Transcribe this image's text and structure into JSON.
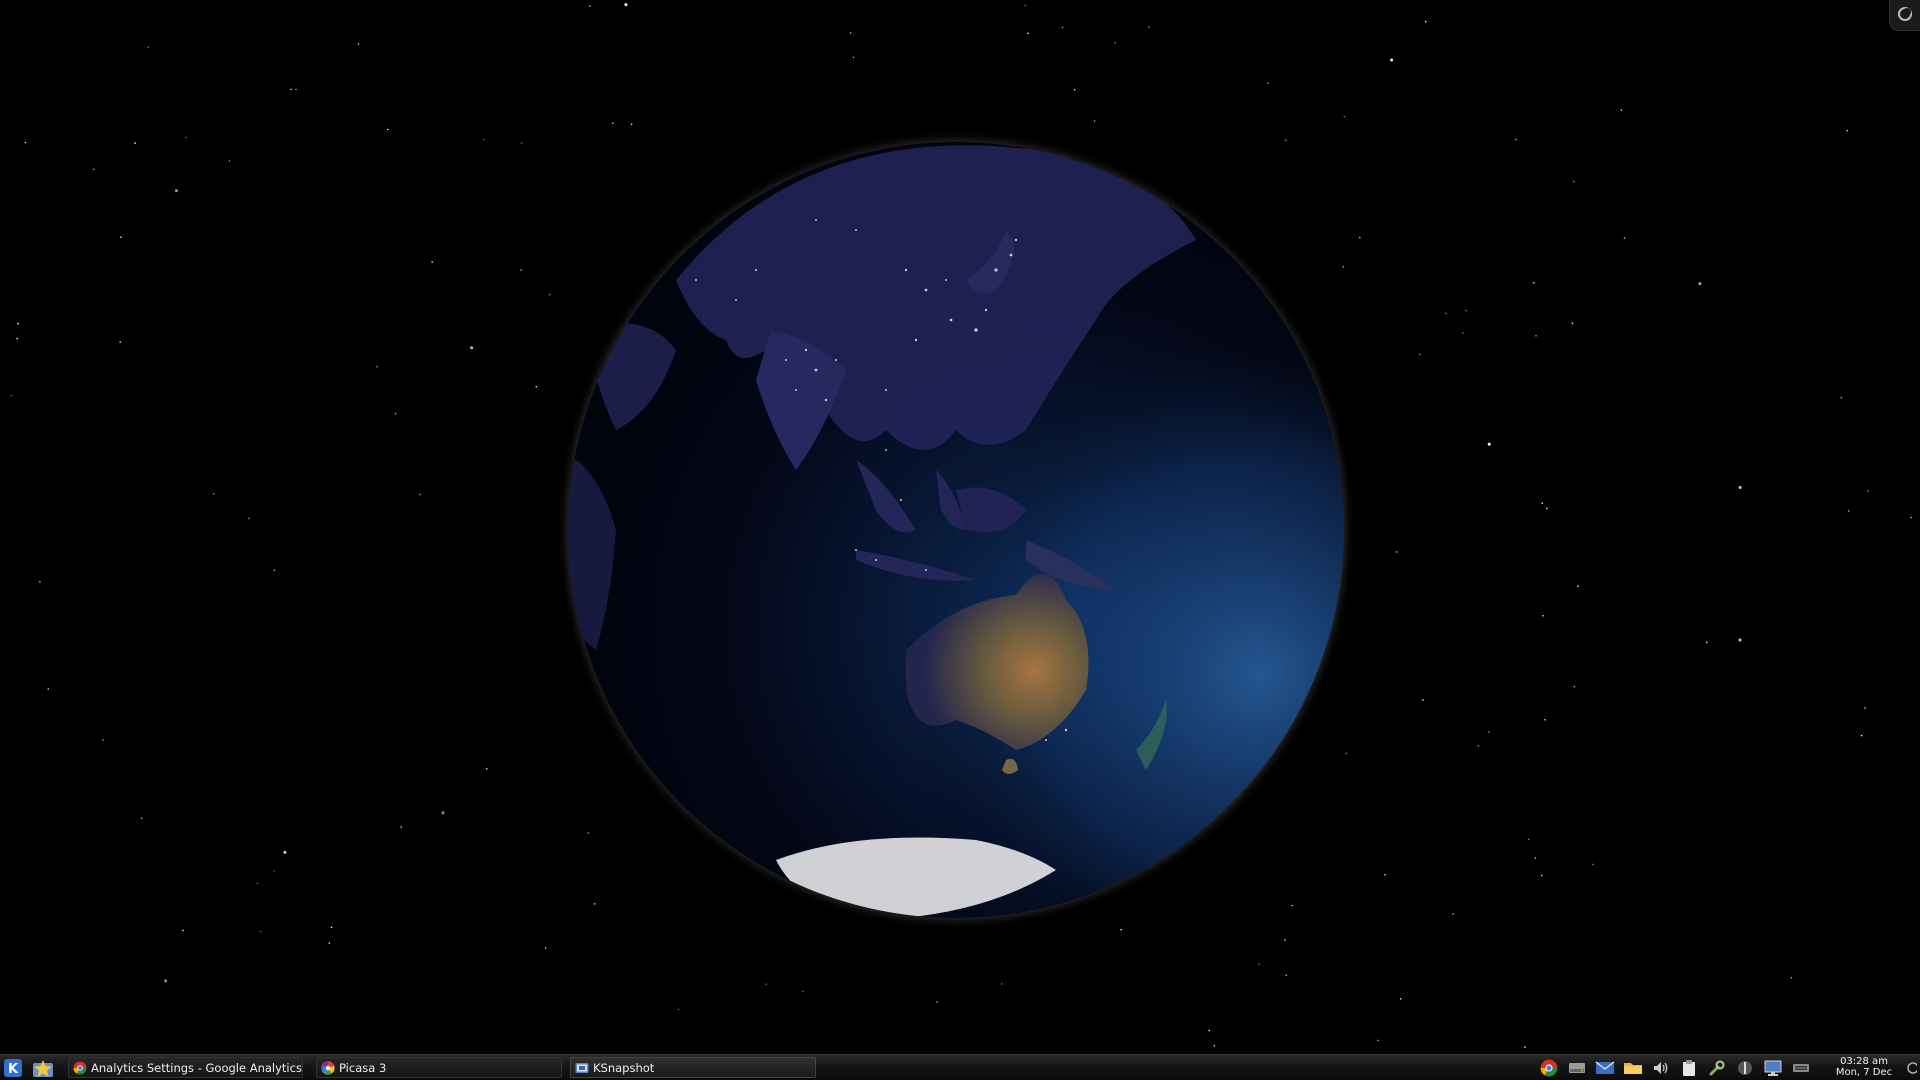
{
  "desktop": {
    "wallpaper": "earth-at-night-globe",
    "colors": {
      "space": "#000000",
      "ocean": "#0a0f2a",
      "land_night": "#2b2f6b",
      "australia_day": "#b07a45",
      "antarctica": "#f4f6fb",
      "atmosphere_glow": "#e8e8e8"
    }
  },
  "taskbar": {
    "kickoff_icon": "kde-logo-icon",
    "favorites_icon": "star-folder-icon",
    "tasks": [
      {
        "label": "Analytics Settings - Google Analytics",
        "icon": "chrome-icon",
        "active": false
      },
      {
        "label": "Picasa 3",
        "icon": "picasa-icon",
        "active": false
      },
      {
        "label": "KSnapshot",
        "icon": "ksnapshot-icon",
        "active": true
      }
    ],
    "tray": [
      "chrome-tray-icon",
      "drive-icon",
      "mail-icon",
      "folder-icon",
      "volume-icon",
      "clipboard-icon",
      "tool-icon",
      "network-icon",
      "display-icon",
      "keyboard-icon"
    ],
    "clock": {
      "time": "03:28 am",
      "date": "Mon, 7 Dec"
    }
  }
}
